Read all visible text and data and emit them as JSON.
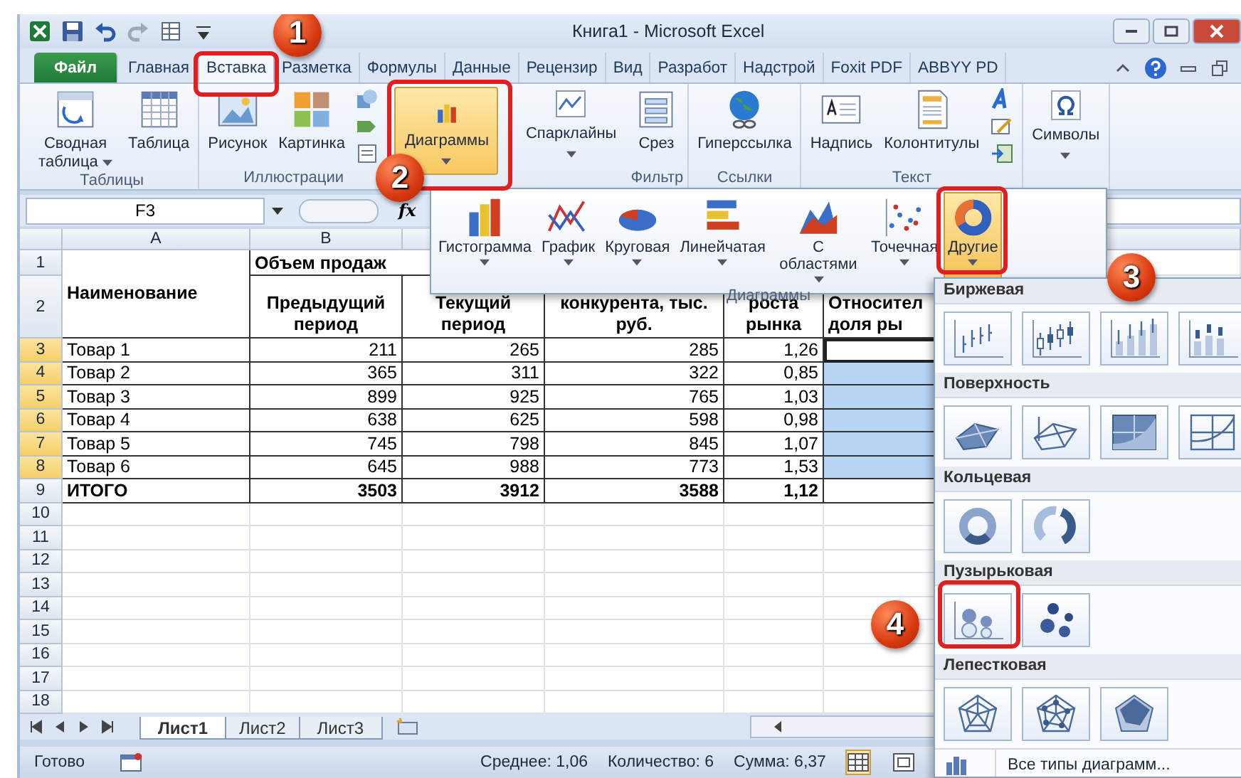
{
  "window": {
    "title": "Книга1 - Microsoft Excel"
  },
  "ribbon_tabs": [
    {
      "label": "Файл",
      "kind": "file",
      "selected": false
    },
    {
      "label": "Главная",
      "kind": "tab",
      "selected": false
    },
    {
      "label": "Вставка",
      "kind": "tab",
      "selected": true
    },
    {
      "label": "Разметка",
      "kind": "tab",
      "selected": false
    },
    {
      "label": "Формулы",
      "kind": "tab",
      "selected": false
    },
    {
      "label": "Данные",
      "kind": "tab",
      "selected": false
    },
    {
      "label": "Рецензир",
      "kind": "tab",
      "selected": false
    },
    {
      "label": "Вид",
      "kind": "tab",
      "selected": false
    },
    {
      "label": "Разработ",
      "kind": "tab",
      "selected": false
    },
    {
      "label": "Надстрой",
      "kind": "tab",
      "selected": false
    },
    {
      "label": "Foxit PDF",
      "kind": "tab",
      "selected": false
    },
    {
      "label": "ABBYY PD",
      "kind": "tab",
      "selected": false
    }
  ],
  "ribbon": {
    "tables": {
      "label": "Таблицы",
      "pivot_table": "Сводная таблица",
      "table": "Таблица"
    },
    "illustrations": {
      "label": "Иллюстрации",
      "picture": "Рисунок",
      "clip_art": "Картинка"
    },
    "charts": {
      "label": "Диаграммы",
      "pressed": true
    },
    "sparklines": {
      "label": "Спарклайны"
    },
    "filter": {
      "label": "Фильтр",
      "slicer": "Срез"
    },
    "links": {
      "label": "Ссылки",
      "hyperlink": "Гиперссылка"
    },
    "text": {
      "label": "Текст",
      "text_box": "Надпись",
      "header_footer": "Колонтитулы"
    },
    "symbols": {
      "label": "Символы"
    }
  },
  "formula_bar": {
    "name_box": "F3",
    "function_label": "fx"
  },
  "sheet": {
    "columns": [
      "A",
      "B"
    ],
    "header_rows": [
      "1",
      "2"
    ],
    "headers": {
      "name": "Наименование",
      "group": "Объем продаж",
      "previous": "Предыдущий период",
      "current": "Текущий период",
      "competitor": "конкурента, тыс. руб.",
      "growth": "роста рынка",
      "share": "Относител доля ры"
    },
    "rows": [
      {
        "number": "3",
        "name": "Товар 1",
        "previous": "211",
        "current": "265",
        "competitor": "285",
        "growth": "1,26",
        "kind": "item",
        "selected": true,
        "active": true
      },
      {
        "number": "4",
        "name": "Товар 2",
        "previous": "365",
        "current": "311",
        "competitor": "322",
        "growth": "0,85",
        "kind": "item",
        "selected": true,
        "active": false
      },
      {
        "number": "5",
        "name": "Товар 3",
        "previous": "899",
        "current": "925",
        "competitor": "765",
        "growth": "1,03",
        "kind": "item",
        "selected": true,
        "active": false
      },
      {
        "number": "6",
        "name": "Товар 4",
        "previous": "638",
        "current": "625",
        "competitor": "598",
        "growth": "0,98",
        "kind": "item",
        "selected": true,
        "active": false
      },
      {
        "number": "7",
        "name": "Товар 5",
        "previous": "745",
        "current": "798",
        "competitor": "845",
        "growth": "1,07",
        "kind": "item",
        "selected": true,
        "active": false
      },
      {
        "number": "8",
        "name": "Товар 6",
        "previous": "645",
        "current": "988",
        "competitor": "773",
        "growth": "1,53",
        "kind": "item",
        "selected": true,
        "active": false
      },
      {
        "number": "9",
        "name": "ИТОГО",
        "previous": "3503",
        "current": "3912",
        "competitor": "3588",
        "growth": "1,12",
        "kind": "total",
        "selected": false,
        "active": false
      }
    ],
    "empty_rows": [
      "10",
      "11",
      "12",
      "13",
      "14",
      "15",
      "16",
      "17",
      "18"
    ]
  },
  "sheet_tabs": [
    {
      "label": "Лист1",
      "selected": true
    },
    {
      "label": "Лист2",
      "selected": false
    },
    {
      "label": "Лист3",
      "selected": false
    }
  ],
  "status_bar": {
    "ready": "Готово",
    "average": "Среднее: 1,06",
    "count": "Количество: 6",
    "sum": "Сумма: 6,37"
  },
  "charts_panel": {
    "group_label": "Диаграммы",
    "chart_types": [
      {
        "label": "Гистограмма",
        "kind": "column",
        "selected": false
      },
      {
        "label": "График",
        "kind": "line",
        "selected": false
      },
      {
        "label": "Круговая",
        "kind": "pie",
        "selected": false
      },
      {
        "label": "Линейчатая",
        "kind": "bar",
        "selected": false
      },
      {
        "label": "С областями",
        "kind": "area",
        "selected": false
      },
      {
        "label": "Точечная",
        "kind": "scatter",
        "selected": false
      },
      {
        "label": "Другие",
        "kind": "other",
        "selected": true
      }
    ]
  },
  "other_charts_menu": {
    "sections": [
      {
        "title": "Биржевая",
        "items": [
          {
            "kind": "hlc"
          },
          {
            "kind": "ohlc"
          },
          {
            "kind": "vhlc"
          },
          {
            "kind": "vohlc"
          }
        ]
      },
      {
        "title": "Поверхность",
        "items": [
          {
            "kind": "surface"
          },
          {
            "kind": "wireframe"
          },
          {
            "kind": "contour"
          },
          {
            "kind": "wirecontour"
          }
        ]
      },
      {
        "title": "Кольцевая",
        "items": [
          {
            "kind": "doughnut"
          },
          {
            "kind": "exploded"
          }
        ]
      },
      {
        "title": "Пузырьковая",
        "items": [
          {
            "kind": "bubble"
          },
          {
            "kind": "bubble3d"
          }
        ]
      },
      {
        "title": "Лепестковая",
        "items": [
          {
            "kind": "radar"
          },
          {
            "kind": "markers"
          },
          {
            "kind": "filled"
          }
        ]
      }
    ],
    "footer": "Все типы диаграмм..."
  },
  "callouts": [
    {
      "number": "1"
    },
    {
      "number": "2"
    },
    {
      "number": "3"
    },
    {
      "number": "4"
    }
  ]
}
